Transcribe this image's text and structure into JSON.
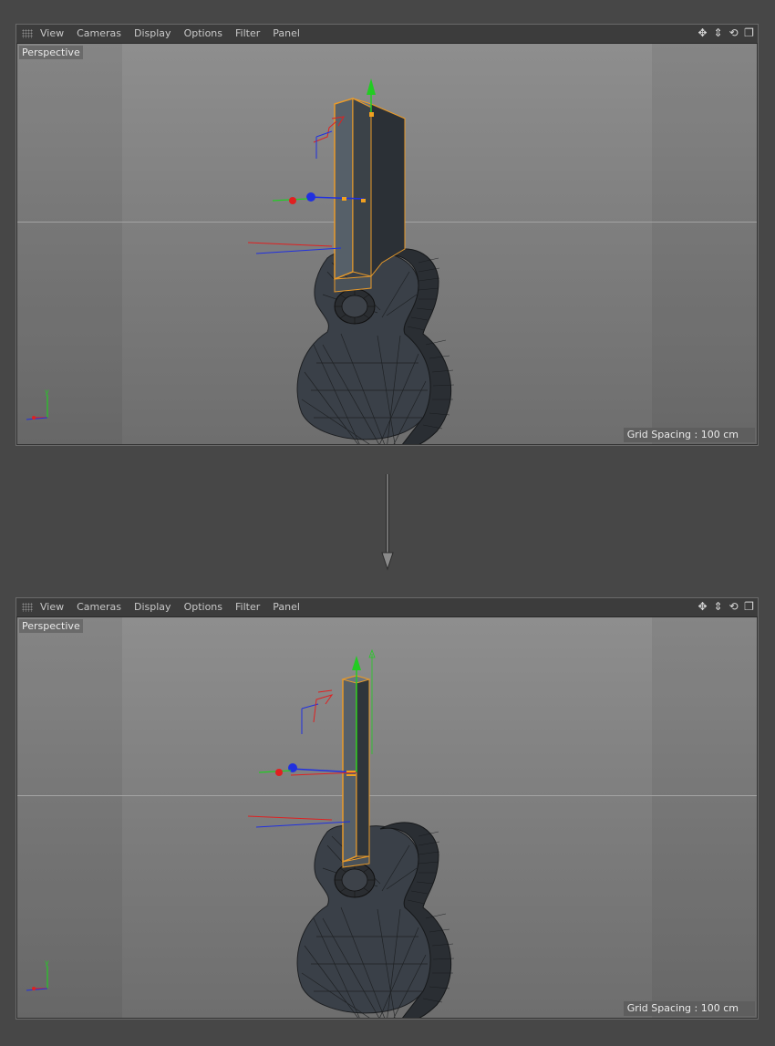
{
  "menu": {
    "view": "View",
    "cameras": "Cameras",
    "display": "Display",
    "options": "Options",
    "filter": "Filter",
    "panel": "Panel"
  },
  "toolbar_icons": [
    "move-view-icon",
    "zoom-view-icon",
    "rotate-view-icon",
    "maximize-view-icon"
  ],
  "viewport_top": {
    "label": "Perspective",
    "grid_spacing": "Grid Spacing : 100 cm"
  },
  "viewport_bottom": {
    "label": "Perspective",
    "grid_spacing": "Grid Spacing : 100 cm"
  },
  "colors": {
    "selection": "#e89a2a",
    "axis_x": "#e02020",
    "axis_y": "#20c020",
    "axis_z": "#2030e0"
  }
}
